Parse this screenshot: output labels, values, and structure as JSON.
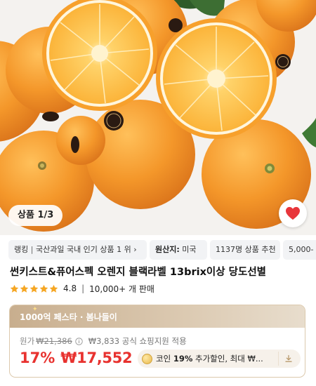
{
  "gallery": {
    "indicator": "상품 1/3"
  },
  "chips": {
    "ranking": {
      "label": "랭킹",
      "separator": "|",
      "text": "국산과일 국내 인기 상품 1 위",
      "arrow": "›"
    },
    "origin": {
      "label": "원산지:",
      "value": "미국"
    },
    "recommend": {
      "text": "1137명 상품 추천"
    },
    "next": {
      "text": "5,000-"
    }
  },
  "product": {
    "title": "썬키스트&퓨어스펙 오렌지 블랙라벨 13brix이상 당도선별",
    "rating": "4.8",
    "stars": 5,
    "sales": "10,000+ 개 판매"
  },
  "price_card": {
    "banner": "1000억 페스타 · 봄나들이",
    "orig_label": "원가",
    "orig_price": "₩21,386",
    "coupon_value": "₩3,833 공식 쇼핑지원 적용",
    "discount": "17%",
    "price": "₩17,552",
    "coin_text_prefix": "코인 ",
    "coin_text_bold": "19%",
    "coin_text_suffix": " 추가할인, 최대 ₩..."
  },
  "colors": {
    "accent_red": "#e8322f",
    "star": "#f5a623",
    "heart": "#e8363b",
    "orange": "#f2962a"
  }
}
